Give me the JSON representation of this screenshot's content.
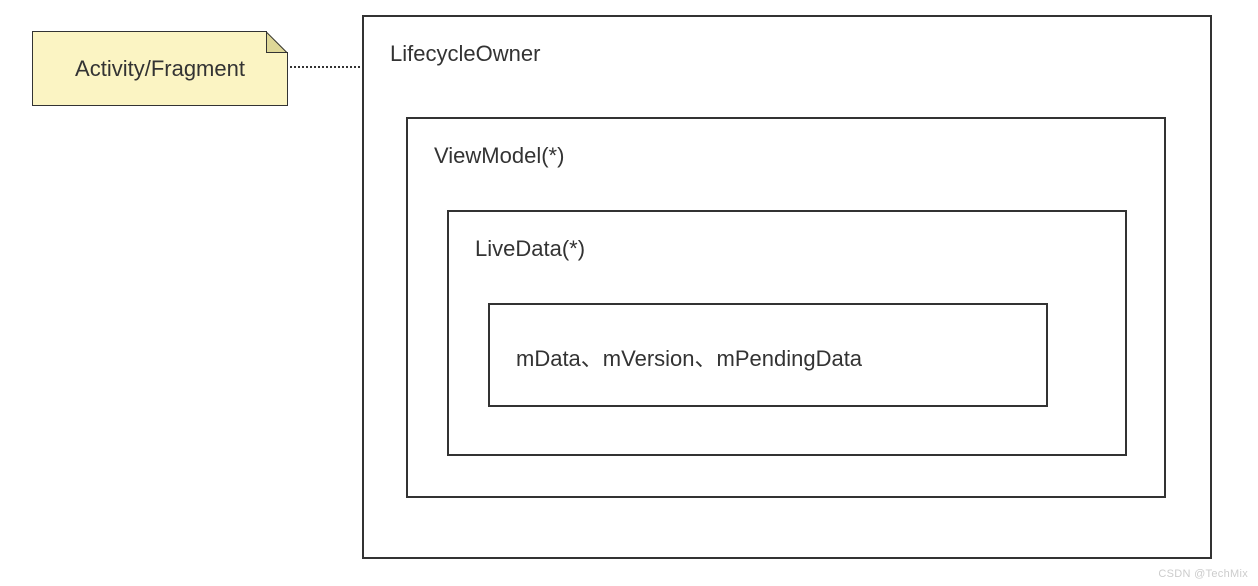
{
  "note": {
    "label": "Activity/Fragment"
  },
  "boxes": {
    "lifecycle": "LifecycleOwner",
    "viewmodel": "ViewModel(*)",
    "livedata": "LiveData(*)",
    "members": "mData、mVersion、mPendingData"
  },
  "watermark": "CSDN @TechMix"
}
